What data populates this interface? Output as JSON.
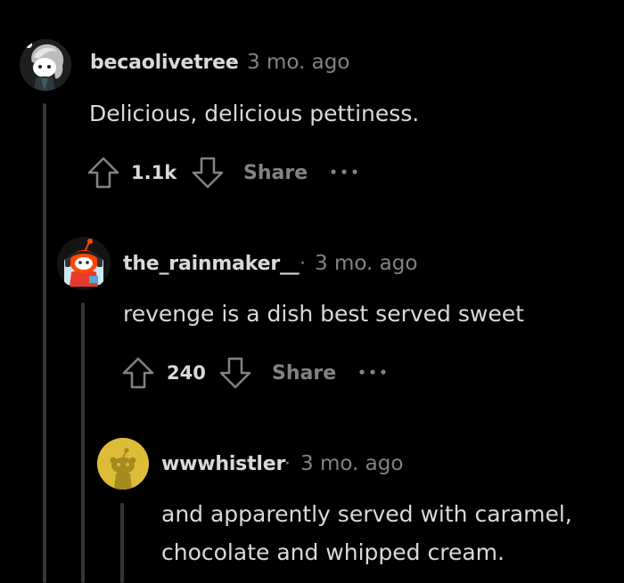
{
  "comments": [
    {
      "username": "becaolivetree",
      "separator": "·",
      "time": "3 mo. ago",
      "body": "Delicious, delicious pettiness.",
      "score": "1.1k",
      "share_label": "Share",
      "avatar": "snoo-avatar-grey-hair"
    },
    {
      "username": "the_rainmaker__",
      "separator": "·",
      "time": "3 mo. ago",
      "body": "revenge is a dish best served sweet",
      "score": "240",
      "share_label": "Share",
      "avatar": "snoo-avatar-red-headphones"
    },
    {
      "username": "wwwhistler",
      "separator": "·",
      "time": "3 mo. ago",
      "body_lines": [
        "and apparently served with caramel,",
        "chocolate and whipped cream."
      ],
      "avatar": "default-snoo-avatar-yellow"
    }
  ],
  "icons": {
    "upvote": "arrow-up-outline-icon",
    "downvote": "arrow-down-outline-icon",
    "more": "ellipsis-icon"
  },
  "colors": {
    "background": "#000000",
    "text": "#d7dadc",
    "muted": "#818384",
    "thread_line": "#343536",
    "yellow_avatar": "#ddbd37"
  }
}
